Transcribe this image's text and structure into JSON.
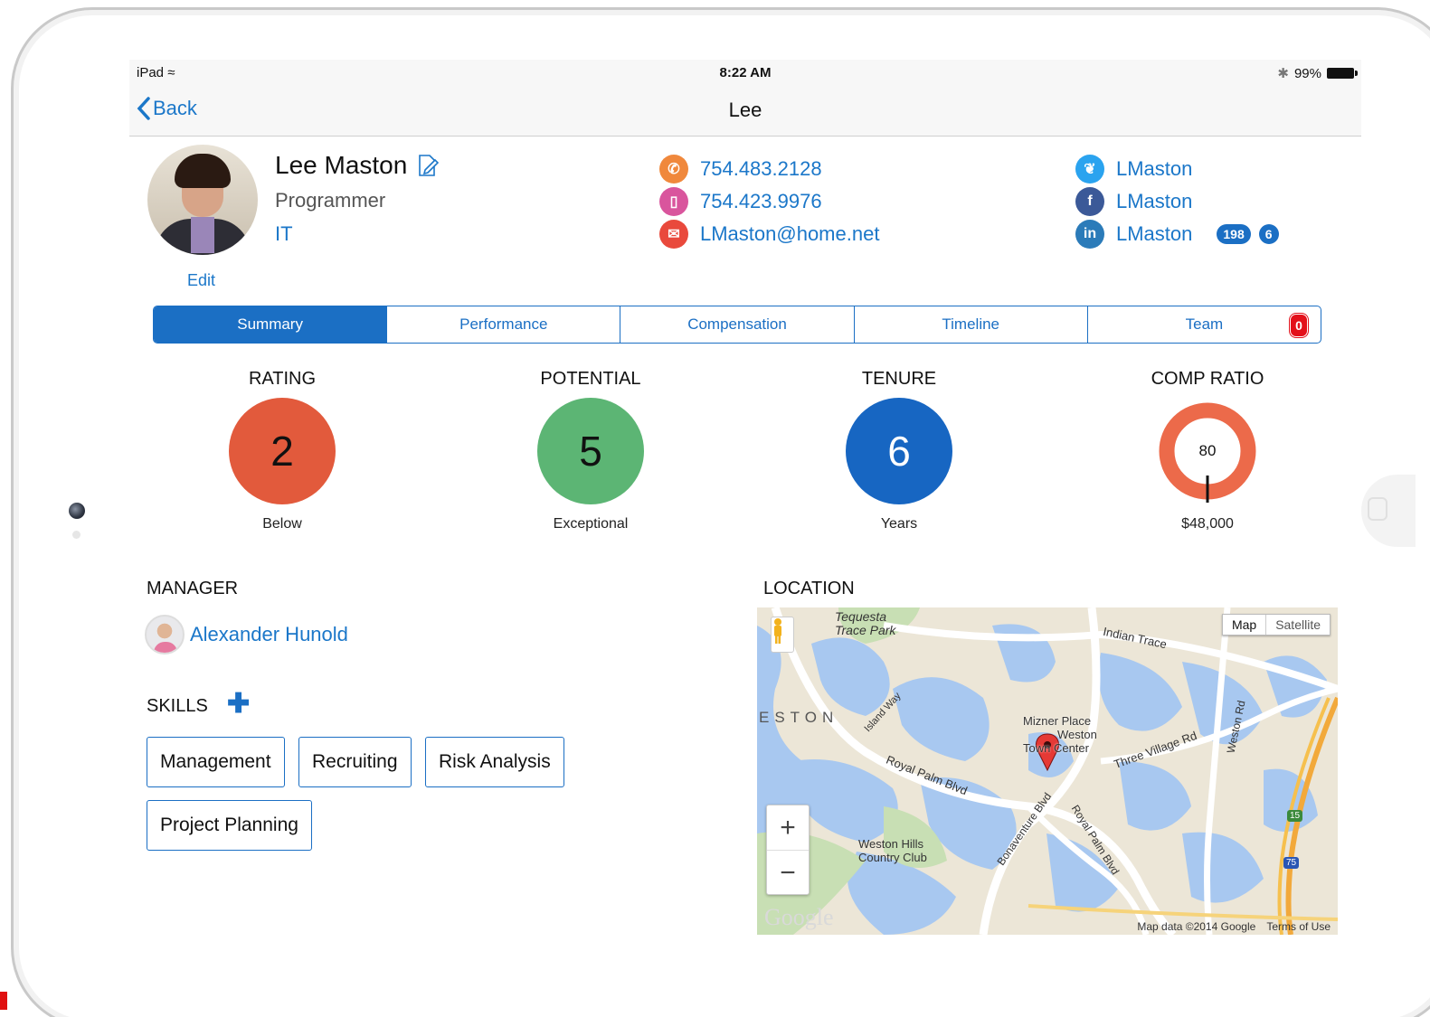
{
  "status_bar": {
    "device": "iPad",
    "time": "8:22 AM",
    "battery": "99%"
  },
  "nav": {
    "back_label": "Back",
    "title": "Lee"
  },
  "profile": {
    "name": "Lee Maston",
    "title": "Programmer",
    "department": "IT",
    "edit_label": "Edit",
    "phones": [
      "754.483.2128",
      "754.423.9976"
    ],
    "email": "LMaston@home.net",
    "twitter": "LMaston",
    "facebook": "LMaston",
    "linkedin": "LMaston",
    "linkedin_badges": [
      "198",
      "6"
    ]
  },
  "tabs": [
    {
      "label": "Summary",
      "active": true
    },
    {
      "label": "Performance"
    },
    {
      "label": "Compensation"
    },
    {
      "label": "Timeline"
    },
    {
      "label": "Team",
      "badge": "0"
    }
  ],
  "metrics": {
    "rating": {
      "label": "RATING",
      "value": "2",
      "sub": "Below",
      "color": "#e25a3c"
    },
    "potential": {
      "label": "POTENTIAL",
      "value": "5",
      "sub": "Exceptional",
      "color": "#5cb574"
    },
    "tenure": {
      "label": "TENURE",
      "value": "6",
      "sub": "Years",
      "color": "#1766c2"
    },
    "comp_ratio": {
      "label": "COMP RATIO",
      "value": "80",
      "sub": "$48,000",
      "color": "#ec6a4a"
    }
  },
  "manager": {
    "section_label": "MANAGER",
    "name": "Alexander Hunold"
  },
  "skills": {
    "section_label": "SKILLS",
    "items": [
      "Management",
      "Recruiting",
      "Risk Analysis",
      "Project Planning"
    ]
  },
  "location": {
    "section_label": "LOCATION",
    "map_btn": "Map",
    "satellite_btn": "Satellite",
    "labels": {
      "park": "Tequesta\nTrace Park",
      "indian_trace": "Indian Trace",
      "weston": "ESTON",
      "island_way": "Island Way",
      "mizner": "Mizner Place",
      "weston2": "Weston",
      "town_center": "Town Center",
      "three_village": "Three Village Rd",
      "weston_rd": "Weston Rd",
      "royal_palm": "Royal Palm Blvd",
      "bonaventure": "Bonaventure Blvd",
      "royal_palm2": "Royal Palm Blvd",
      "hills": "Weston Hills\nCountry Club",
      "shield15": "15",
      "shield75": "75"
    },
    "google": "Google",
    "attribution": "Map data ©2014 Google",
    "terms": "Terms of Use"
  },
  "colors": {
    "accent": "#1b6fc4",
    "phone": "#f0883c",
    "mobile": "#d9559d",
    "email": "#e9493c",
    "twitter": "#2aa3ef",
    "facebook": "#3b5998",
    "linkedin": "#2b7bb9"
  }
}
